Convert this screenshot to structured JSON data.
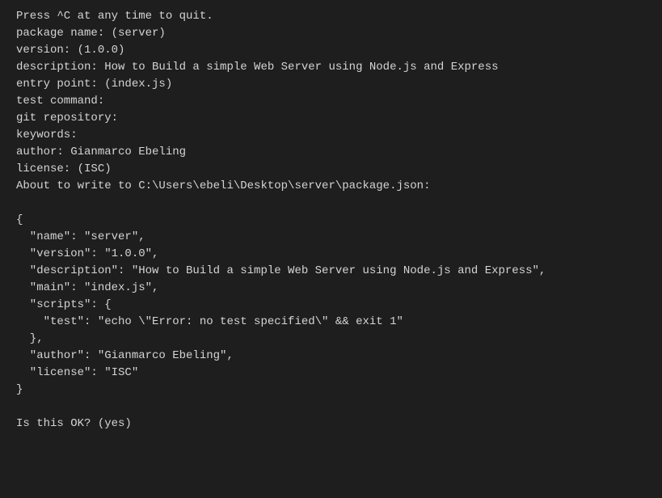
{
  "prompts": {
    "quit_hint": "Press ^C at any time to quit.",
    "package_name": "package name: (server)",
    "version": "version: (1.0.0)",
    "description": "description: How to Build a simple Web Server using Node.js and Express",
    "entry_point": "entry point: (index.js)",
    "test_command": "test command:",
    "git_repository": "git repository:",
    "keywords": "keywords:",
    "author": "author: Gianmarco Ebeling",
    "license": "license: (ISC)",
    "about_to_write": "About to write to C:\\Users\\ebeli\\Desktop\\server\\package.json:"
  },
  "json_output": {
    "open_brace": "{",
    "name_line": "  \"name\": \"server\",",
    "version_line": "  \"version\": \"1.0.0\",",
    "description_line": "  \"description\": \"How to Build a simple Web Server using Node.js and Express\",",
    "main_line": "  \"main\": \"index.js\",",
    "scripts_open": "  \"scripts\": {",
    "test_line": "    \"test\": \"echo \\\"Error: no test specified\\\" && exit 1\"",
    "scripts_close": "  },",
    "author_line": "  \"author\": \"Gianmarco Ebeling\",",
    "license_line": "  \"license\": \"ISC\"",
    "close_brace": "}"
  },
  "confirm": {
    "prompt": "Is this OK? (yes) "
  }
}
